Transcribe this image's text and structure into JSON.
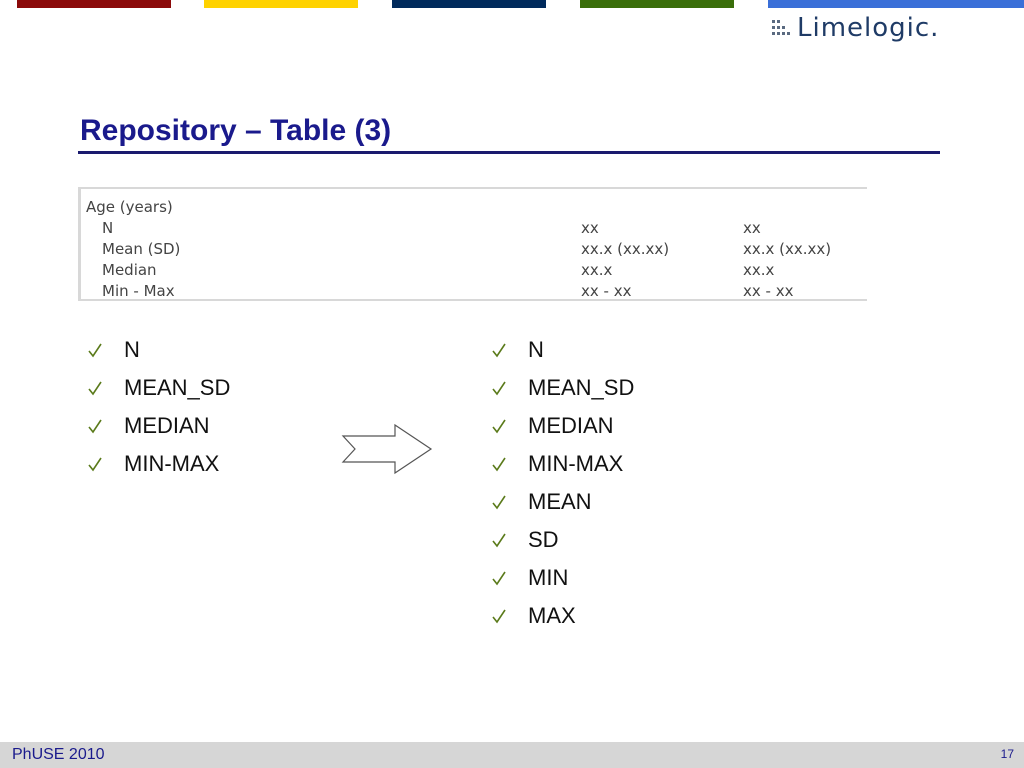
{
  "colors": {
    "bar_red": "#8b0a0a",
    "bar_yellow": "#ffd200",
    "bar_navy": "#002a5c",
    "bar_green": "#3a6e0a",
    "bar_blue": "#3a6fd8",
    "title": "#1a1a8c",
    "check": "#5a7a1a"
  },
  "header": {
    "logo_text": "Limelogic."
  },
  "title": "Repository – Table (3)",
  "table_snippet": {
    "rows": [
      [
        "Age (years)",
        "",
        ""
      ],
      [
        "N",
        "xx",
        "xx"
      ],
      [
        "Mean (SD)",
        "xx.x (xx.xx)",
        "xx.x (xx.xx)"
      ],
      [
        "Median",
        "xx.x",
        "xx.x"
      ],
      [
        "Min - Max",
        "xx - xx",
        "xx - xx"
      ]
    ]
  },
  "left_list": [
    "N",
    "MEAN_SD",
    "MEDIAN",
    "MIN-MAX"
  ],
  "right_list": [
    "N",
    "MEAN_SD",
    "MEDIAN",
    "MIN-MAX",
    "MEAN",
    "SD",
    "MIN",
    "MAX"
  ],
  "arrow_icon": "right-arrow-icon",
  "check_icon": "checkmark-icon",
  "footer": {
    "left": "PhUSE 2010",
    "page": "17"
  }
}
